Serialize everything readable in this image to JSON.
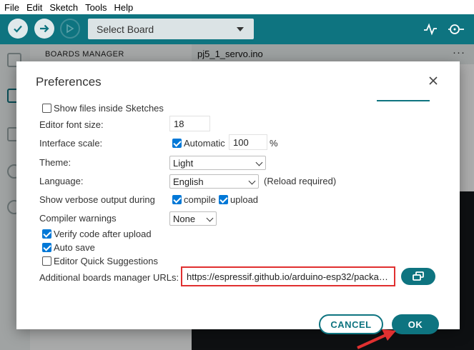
{
  "menu": [
    "File",
    "Edit",
    "Sketch",
    "Tools",
    "Help"
  ],
  "toolbar": {
    "verify_icon": "check-icon",
    "upload_icon": "arrow-right-icon",
    "debug_icon": "debug-icon",
    "board_select": "Select Board",
    "serial_plotter_icon": "serial-plotter-icon",
    "serial_monitor_icon": "serial-monitor-icon"
  },
  "background": {
    "panel_title": "BOARDS MANAGER",
    "tab_name": "pj5_1_servo.ino",
    "tab_more": "···"
  },
  "dialog": {
    "title": "Preferences",
    "show_files": {
      "label": "Show files inside Sketches",
      "checked": false
    },
    "editor_font_size": {
      "label": "Editor font size:",
      "value": "18"
    },
    "interface_scale": {
      "label": "Interface scale:",
      "automatic_label": "Automatic",
      "automatic_checked": true,
      "value": "100",
      "unit": "%"
    },
    "theme": {
      "label": "Theme:",
      "value": "Light"
    },
    "language": {
      "label": "Language:",
      "value": "English",
      "note": "(Reload required)"
    },
    "verbose": {
      "label": "Show verbose output during",
      "compile_label": "compile",
      "compile_checked": true,
      "upload_label": "upload",
      "upload_checked": true
    },
    "compiler_warnings": {
      "label": "Compiler warnings",
      "value": "None"
    },
    "verify_after_upload": {
      "label": "Verify code after upload",
      "checked": true
    },
    "auto_save": {
      "label": "Auto save",
      "checked": true
    },
    "quick_suggestions": {
      "label": "Editor Quick Suggestions",
      "checked": false
    },
    "boards_urls": {
      "label": "Additional boards manager URLs:",
      "value": "https://espressif.github.io/arduino-esp32/packa…"
    },
    "cancel_label": "CANCEL",
    "ok_label": "OK"
  },
  "colors": {
    "accent": "#0e7480",
    "highlight": "#e03030",
    "checkbox": "#0078d7"
  }
}
